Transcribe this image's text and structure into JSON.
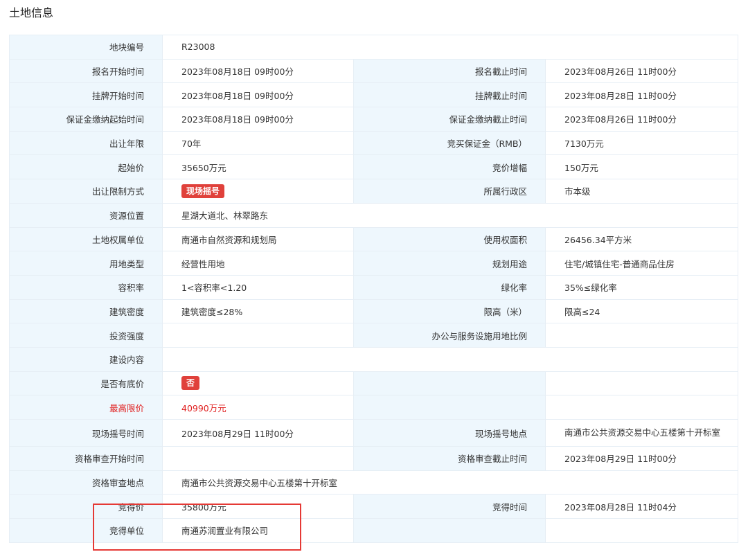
{
  "section_title": "土地信息",
  "rows": {
    "r1": {
      "l1": "地块编号",
      "v1": "R23008"
    },
    "r2": {
      "l1": "报名开始时间",
      "v1": "2023年08月18日 09时00分",
      "l2": "报名截止时间",
      "v2": "2023年08月26日 11时00分"
    },
    "r3": {
      "l1": "挂牌开始时间",
      "v1": "2023年08月18日 09时00分",
      "l2": "挂牌截止时间",
      "v2": "2023年08月28日 11时00分"
    },
    "r4": {
      "l1": "保证金缴纳起始时间",
      "v1": "2023年08月18日 09时00分",
      "l2": "保证金缴纳截止时间",
      "v2": "2023年08月26日 11时00分"
    },
    "r5": {
      "l1": "出让年限",
      "v1": "70年",
      "l2": "竞买保证金（RMB）",
      "v2": "7130万元"
    },
    "r6": {
      "l1": "起始价",
      "v1": "35650万元",
      "l2": "竞价增幅",
      "v2": "150万元"
    },
    "r7": {
      "l1": "出让限制方式",
      "tag": "现场摇号",
      "l2": "所属行政区",
      "v2": "市本级"
    },
    "r8": {
      "l1": "资源位置",
      "v1": "星湖大道北、林翠路东"
    },
    "r9": {
      "l1": "土地权属单位",
      "v1": "南通市自然资源和规划局",
      "l2": "使用权面积",
      "v2": "26456.34平方米"
    },
    "r10": {
      "l1": "用地类型",
      "v1": "经营性用地",
      "l2": "规划用途",
      "v2": "住宅/城镇住宅-普通商品住房"
    },
    "r11": {
      "l1": "容积率",
      "v1": "1<容积率<1.20",
      "l2": "绿化率",
      "v2": "35%≤绿化率"
    },
    "r12": {
      "l1": "建筑密度",
      "v1": "建筑密度≤28%",
      "l2": "限高（米）",
      "v2": "限高≤24"
    },
    "r13": {
      "l1": "投资强度",
      "v1": "",
      "l2": "办公与服务设施用地比例",
      "v2": ""
    },
    "r14": {
      "l1": "建设内容",
      "v1": ""
    },
    "r15": {
      "l1": "是否有底价",
      "tag": "否"
    },
    "r16": {
      "l1": "最高限价",
      "v1": "40990万元"
    },
    "r17": {
      "l1": "现场摇号时间",
      "v1": "2023年08月29日 11时00分",
      "l2": "现场摇号地点",
      "v2": "南通市公共资源交易中心五楼第十开标室"
    },
    "r18": {
      "l1": "资格审查开始时间",
      "v1": "",
      "l2": "资格审查截止时间",
      "v2": "2023年08月29日 11时00分"
    },
    "r19": {
      "l1": "资格审查地点",
      "v1": "南通市公共资源交易中心五楼第十开标室"
    },
    "r20": {
      "l1": "竞得价",
      "v1": "35800万元",
      "l2": "竞得时间",
      "v2": "2023年08月28日 11时04分"
    },
    "r21": {
      "l1": "竞得单位",
      "v1": "南通苏润置业有限公司",
      "l2": "",
      "v2": ""
    }
  },
  "colors": {
    "label_bg": "#eef7fd",
    "border": "#e6eef5",
    "tag_red": "#e0413b",
    "highlight_text": "#e02020",
    "annotation_box": "#e53935"
  }
}
